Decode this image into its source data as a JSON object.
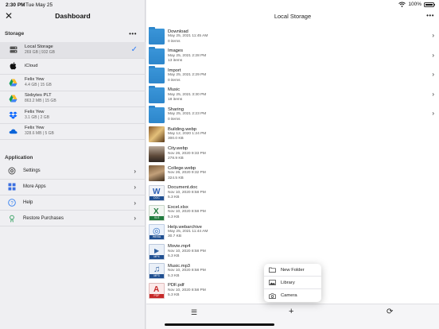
{
  "status": {
    "time": "2:30 PM",
    "date": "Tue May 25",
    "battery": "100%"
  },
  "sidebar": {
    "title": "Dashboard",
    "storage_label": "Storage",
    "more_glyph": "•••",
    "storage_items": [
      {
        "name": "Local Storage",
        "sub": "269 GB | 932 GB",
        "icon": "drive-icon",
        "selected": true
      },
      {
        "name": "iCloud",
        "sub": "",
        "icon": "apple-icon"
      },
      {
        "name": "Felix Yew",
        "sub": "4.4 GB | 15 GB",
        "icon": "google-drive-icon"
      },
      {
        "name": "Sixbytes PLT",
        "sub": "863.2 MB | 15 GB",
        "icon": "google-drive-icon"
      },
      {
        "name": "Felix Yew",
        "sub": "3.1 GB | 2 GB",
        "icon": "dropbox-icon"
      },
      {
        "name": "Felix Yew",
        "sub": "328.6 MB | 5 GB",
        "icon": "onedrive-icon"
      }
    ],
    "application_label": "Application",
    "app_items": [
      {
        "name": "Settings",
        "icon": "gear-icon"
      },
      {
        "name": "More Apps",
        "icon": "grid-icon"
      },
      {
        "name": "Help",
        "icon": "help-icon"
      },
      {
        "name": "Restore Purchases",
        "icon": "restore-icon"
      }
    ]
  },
  "main": {
    "title": "Local Storage",
    "more_glyph": "•••",
    "files": [
      {
        "name": "Download",
        "date": "May 25, 2021 11:45 AM",
        "size": "0 items",
        "kind": "folder"
      },
      {
        "name": "Images",
        "date": "May 25, 2021 2:28 PM",
        "size": "13 items",
        "kind": "folder"
      },
      {
        "name": "Import",
        "date": "May 25, 2021 2:29 PM",
        "size": "0 items",
        "kind": "folder"
      },
      {
        "name": "Music",
        "date": "May 25, 2021 3:30 PM",
        "size": "18 items",
        "kind": "folder"
      },
      {
        "name": "Sharing",
        "date": "May 25, 2021 2:23 PM",
        "size": "0 items",
        "kind": "folder"
      },
      {
        "name": "Building.webp",
        "date": "May 12, 2020 1:24 PM",
        "size": "300.0 KB",
        "kind": "img1"
      },
      {
        "name": "City.webp",
        "date": "Nov 26, 2020 9:33 PM",
        "size": "278.9 KB",
        "kind": "img2"
      },
      {
        "name": "College.webp",
        "date": "Nov 26, 2020 9:32 PM",
        "size": "324.5 KB",
        "kind": "img3"
      },
      {
        "name": "Document.doc",
        "date": "Nov 10, 2020 8:58 PM",
        "size": "5.3 KB",
        "kind": "doc",
        "tag": "DOC"
      },
      {
        "name": "Excel.xlsx",
        "date": "Nov 10, 2020 8:58 PM",
        "size": "5.3 KB",
        "kind": "xls",
        "tag": "XLS"
      },
      {
        "name": "Help.webarchive",
        "date": "May 25, 2021 11:44 AM",
        "size": "30.7 KB",
        "kind": "web",
        "tag": "WEBA"
      },
      {
        "name": "Movie.mp4",
        "date": "Nov 10, 2020 8:58 PM",
        "size": "5.3 KB",
        "kind": "mp4",
        "tag": "MP4"
      },
      {
        "name": "Music.mp3",
        "date": "Nov 10, 2020 8:58 PM",
        "size": "5.3 KB",
        "kind": "mp3",
        "tag": "MP3"
      },
      {
        "name": "PDF.pdf",
        "date": "Nov 10, 2020 8:58 PM",
        "size": "5.3 KB",
        "kind": "pdf",
        "tag": "PDF"
      }
    ]
  },
  "popover": {
    "items": [
      {
        "label": "New Folder",
        "icon": "new-folder-icon"
      },
      {
        "label": "Library",
        "icon": "photo-library-icon"
      },
      {
        "label": "Camera",
        "icon": "camera-icon"
      }
    ]
  },
  "toolbar": {
    "add_glyph": "+",
    "list_glyph": "☰",
    "refresh_glyph": "⟳"
  }
}
